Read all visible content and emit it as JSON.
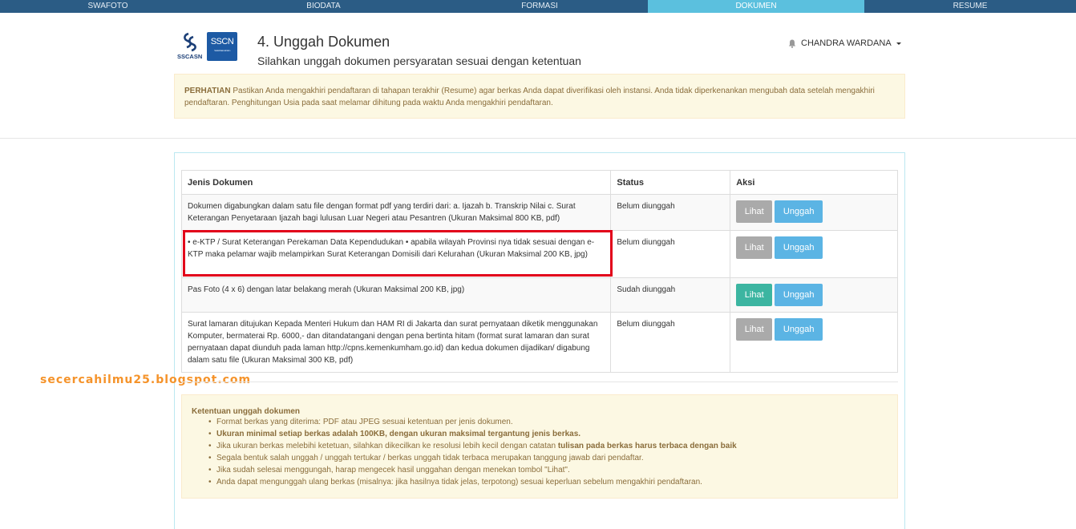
{
  "nav": {
    "tabs": [
      {
        "label": "SWAFOTO",
        "active": false
      },
      {
        "label": "BIODATA",
        "active": false
      },
      {
        "label": "FORMASI",
        "active": false
      },
      {
        "label": "DOKUMEN",
        "active": true
      },
      {
        "label": "RESUME",
        "active": false
      }
    ]
  },
  "logo": {
    "sscasn": "SSCASN",
    "sscn": "SSCN",
    "sscn_sub": "Seleksi Nasional Calon"
  },
  "header": {
    "title": "4. Unggah Dokumen",
    "subtitle": "Silahkan unggah dokumen persyaratan sesuai dengan ketentuan",
    "user_name": "CHANDRA WARDANA",
    "user_icon": "bell-icon"
  },
  "notice": {
    "label": "PERHATIAN",
    "text": " Pastikan Anda mengakhiri pendaftaran di tahapan terakhir (Resume) agar berkas Anda dapat diverifikasi oleh instansi. Anda tidak diperkenankan mengubah data setelah mengakhiri pendaftaran. Penghitungan Usia pada saat melamar dihitung pada waktu Anda mengakhiri pendaftaran."
  },
  "table": {
    "headers": {
      "doc": "Jenis Dokumen",
      "status": "Status",
      "action": "Aksi"
    },
    "rows": [
      {
        "doc": "Dokumen digabungkan dalam satu file dengan format pdf yang terdiri dari: a. Ijazah b. Transkrip Nilai c. Surat Keterangan Penyetaraan Ijazah bagi lulusan Luar Negeri atau Pesantren (Ukuran Maksimal 800 KB, pdf)",
        "status": "Belum diunggah",
        "view": "Lihat",
        "upload": "Unggah",
        "uploaded": false
      },
      {
        "doc": "• e-KTP / Surat Keterangan Perekaman Data Kependudukan • apabila wilayah Provinsi nya tidak sesuai dengan e-KTP maka pelamar wajib melampirkan Surat Keterangan Domisili dari Kelurahan (Ukuran Maksimal 200 KB, jpg)",
        "status": "Belum diunggah",
        "view": "Lihat",
        "upload": "Unggah",
        "uploaded": false
      },
      {
        "doc": "Pas Foto (4 x 6) dengan latar belakang merah (Ukuran Maksimal 200 KB, jpg)",
        "status": "Sudah diunggah",
        "view": "Lihat",
        "upload": "Unggah",
        "uploaded": true
      },
      {
        "doc": "Surat lamaran ditujukan Kepada Menteri Hukum dan HAM RI di Jakarta dan surat pernyataan diketik menggunakan Komputer, bermaterai Rp. 6000,- dan ditandatangani dengan pena bertinta hitam (format surat lamaran dan surat pernyataan dapat diunduh pada laman http://cpns.kemenkumham.go.id) dan kedua dokumen dijadikan/ digabung dalam satu file (Ukuran Maksimal 300 KB, pdf)",
        "status": "Belum diunggah",
        "view": "Lihat",
        "upload": "Unggah",
        "uploaded": false
      }
    ]
  },
  "watermark": "secercahilmu25.blogspot.com",
  "rules": {
    "title": "Ketentuan unggah dokumen",
    "items": [
      {
        "pre": "Format berkas yang diterima: PDF atau JPEG sesuai ketentuan per jenis dokumen.",
        "bold": "",
        "post": ""
      },
      {
        "pre": "",
        "bold": "Ukuran minimal setiap berkas adalah 100KB, dengan ukuran maksimal tergantung jenis berkas.",
        "post": ""
      },
      {
        "pre": "Jika ukuran berkas melebihi ketetuan, silahkan dikecilkan ke resolusi lebih kecil dengan catatan ",
        "bold": "tulisan pada berkas harus terbaca dengan baik",
        "post": ""
      },
      {
        "pre": "Segala bentuk salah unggah / unggah tertukar / berkas unggah tidak terbaca merupakan tanggung jawab dari pendaftar.",
        "bold": "",
        "post": ""
      },
      {
        "pre": "Jika sudah selesai menggungah, harap mengecek hasil unggahan dengan menekan tombol \"Lihat\".",
        "bold": "",
        "post": ""
      },
      {
        "pre": "Anda dapat mengunggah ulang berkas (misalnya: jika hasilnya tidak jelas, terpotong) sesuai keperluan sebelum mengakhiri pendaftaran.",
        "bold": "",
        "post": ""
      }
    ]
  },
  "colors": {
    "nav_bg": "#2b5c85",
    "nav_active": "#5bc0de",
    "btn_upload": "#5bb4e4",
    "btn_view_disabled": "#aaaaaa",
    "btn_view_ok": "#3cb5a1",
    "highlight": "#e2001a",
    "watermark": "#f5932a"
  }
}
